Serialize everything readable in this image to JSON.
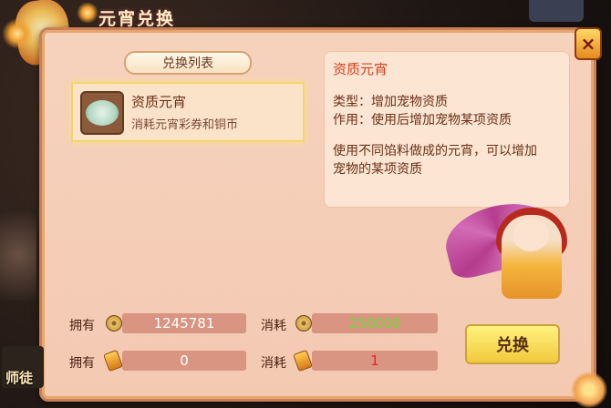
{
  "window": {
    "title": "元宵兑换",
    "close_label": "×"
  },
  "list": {
    "header": "兑换列表",
    "items": [
      {
        "name": "资质元宵",
        "desc": "消耗元宵彩券和铜币",
        "icon": "tangyuan-bowl-icon"
      }
    ]
  },
  "detail": {
    "title": "资质元宵",
    "type_line": "类型：增加宠物资质",
    "effect_line": "作用：使用后增加宠物某项资质",
    "desc_line1": "使用不同馅料做成的元宵，可以增加",
    "desc_line2": "宠物的某项资质"
  },
  "resources": {
    "own_label": "拥有",
    "cost_label": "消耗",
    "coins_owned": "1245781",
    "coins_cost": "250000",
    "tickets_owned": "0",
    "tickets_cost": "1"
  },
  "colors": {
    "coins_cost": "#6fdc3a",
    "tickets_cost": "#e8232a",
    "accent": "#d83e1d"
  },
  "exchange_button": "兑换",
  "side": {
    "label": "师徒"
  }
}
